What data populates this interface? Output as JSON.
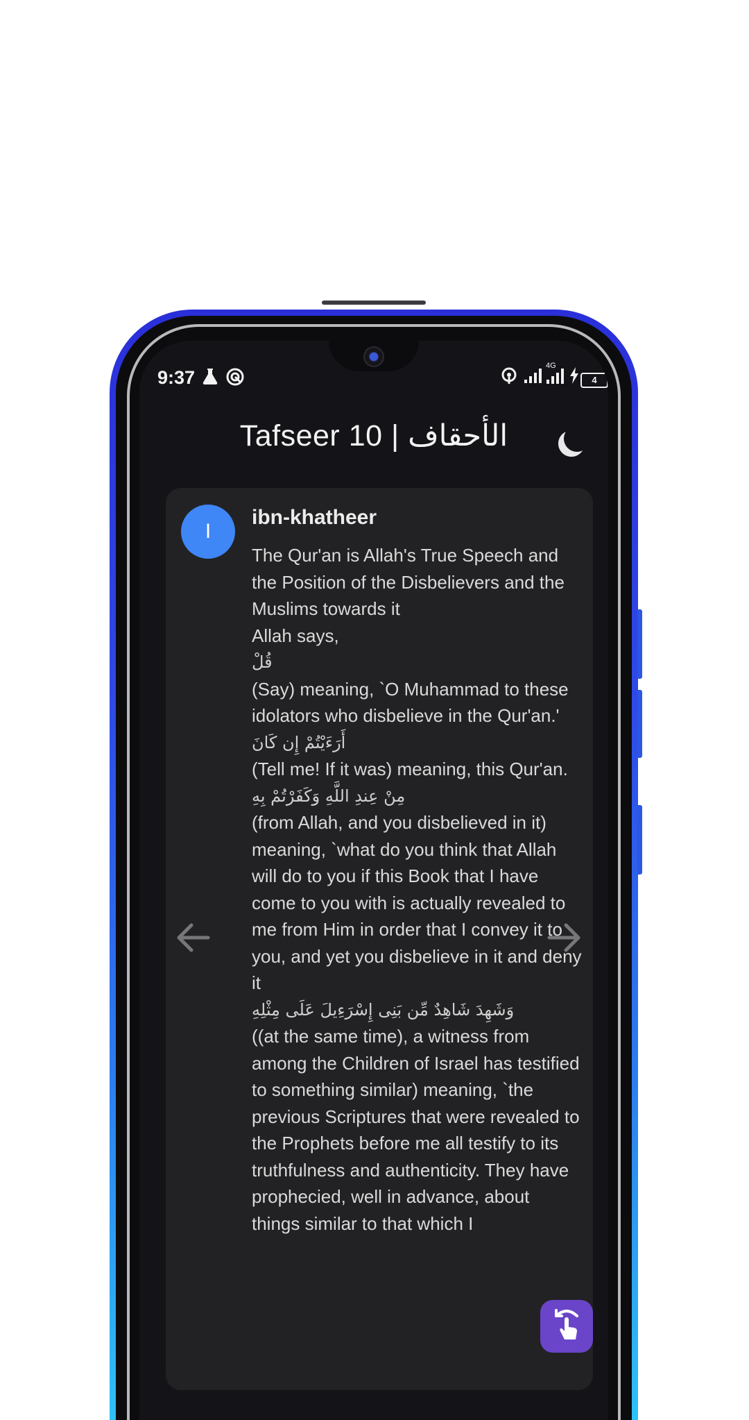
{
  "status_bar": {
    "time": "9:37",
    "battery": "4",
    "network": "4G"
  },
  "app_bar": {
    "title": "Tafseer  10 | الأحقاف",
    "theme_icon": "moon-icon"
  },
  "card": {
    "avatar_letter": "I",
    "author": "ibn-khatheer",
    "paragraphs": [
      {
        "type": "text",
        "text": "The Qur'an is Allah's True Speech and the Position of the Disbelievers and the Muslims towards it"
      },
      {
        "type": "text",
        "text": "Allah says,"
      },
      {
        "type": "arabic",
        "text": "قُلْ"
      },
      {
        "type": "text",
        "text": "(Say) meaning, `O Muhammad to these idolators who disbelieve in the Qur'an.'"
      },
      {
        "type": "arabic",
        "text": "أَرَءَيْتُمْ إِن كَانَ"
      },
      {
        "type": "text",
        "text": "(Tell me! If it was) meaning, this Qur'an."
      },
      {
        "type": "arabic",
        "text": "مِنْ عِندِ اللَّهِ وَكَفَرْتُمْ بِهِ"
      },
      {
        "type": "text",
        "text": "(from Allah, and you disbelieved in it) meaning, `what do you think that Allah will do to you if this Book that I have come to you with is actually revealed to me from Him in order that I convey it to you, and yet you disbelieve in it and deny it"
      },
      {
        "type": "arabic",
        "text": "وَشَهِدَ شَاهِدٌ مِّن بَنِى إِسْرَءِيلَ عَلَى مِثْلِهِ"
      },
      {
        "type": "text",
        "text": "((at the same time), a witness from among the Children of Israel has testified to something similar) meaning, `the previous Scriptures that were revealed to the Prophets before me all testify to its truthfulness and authenticity. They have prophecied, well in advance, about things similar to that which I"
      }
    ]
  },
  "icons": {
    "prev": "arrow-left-icon",
    "next": "arrow-right-icon",
    "fab": "touch-gesture-icon"
  }
}
